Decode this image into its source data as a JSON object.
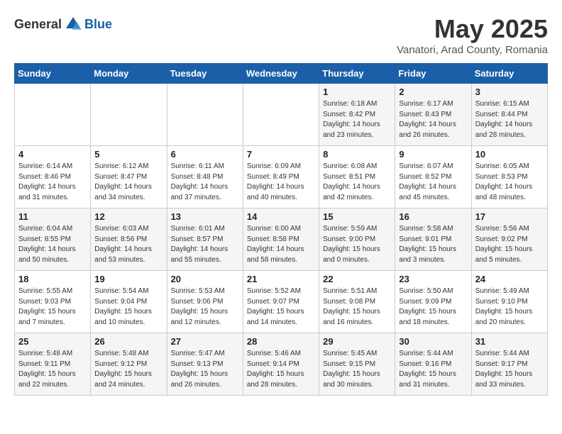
{
  "header": {
    "logo_general": "General",
    "logo_blue": "Blue",
    "month": "May 2025",
    "location": "Vanatori, Arad County, Romania"
  },
  "weekdays": [
    "Sunday",
    "Monday",
    "Tuesday",
    "Wednesday",
    "Thursday",
    "Friday",
    "Saturday"
  ],
  "weeks": [
    [
      {
        "day": "",
        "info": ""
      },
      {
        "day": "",
        "info": ""
      },
      {
        "day": "",
        "info": ""
      },
      {
        "day": "",
        "info": ""
      },
      {
        "day": "1",
        "info": "Sunrise: 6:18 AM\nSunset: 8:42 PM\nDaylight: 14 hours\nand 23 minutes."
      },
      {
        "day": "2",
        "info": "Sunrise: 6:17 AM\nSunset: 8:43 PM\nDaylight: 14 hours\nand 26 minutes."
      },
      {
        "day": "3",
        "info": "Sunrise: 6:15 AM\nSunset: 8:44 PM\nDaylight: 14 hours\nand 28 minutes."
      }
    ],
    [
      {
        "day": "4",
        "info": "Sunrise: 6:14 AM\nSunset: 8:46 PM\nDaylight: 14 hours\nand 31 minutes."
      },
      {
        "day": "5",
        "info": "Sunrise: 6:12 AM\nSunset: 8:47 PM\nDaylight: 14 hours\nand 34 minutes."
      },
      {
        "day": "6",
        "info": "Sunrise: 6:11 AM\nSunset: 8:48 PM\nDaylight: 14 hours\nand 37 minutes."
      },
      {
        "day": "7",
        "info": "Sunrise: 6:09 AM\nSunset: 8:49 PM\nDaylight: 14 hours\nand 40 minutes."
      },
      {
        "day": "8",
        "info": "Sunrise: 6:08 AM\nSunset: 8:51 PM\nDaylight: 14 hours\nand 42 minutes."
      },
      {
        "day": "9",
        "info": "Sunrise: 6:07 AM\nSunset: 8:52 PM\nDaylight: 14 hours\nand 45 minutes."
      },
      {
        "day": "10",
        "info": "Sunrise: 6:05 AM\nSunset: 8:53 PM\nDaylight: 14 hours\nand 48 minutes."
      }
    ],
    [
      {
        "day": "11",
        "info": "Sunrise: 6:04 AM\nSunset: 8:55 PM\nDaylight: 14 hours\nand 50 minutes."
      },
      {
        "day": "12",
        "info": "Sunrise: 6:03 AM\nSunset: 8:56 PM\nDaylight: 14 hours\nand 53 minutes."
      },
      {
        "day": "13",
        "info": "Sunrise: 6:01 AM\nSunset: 8:57 PM\nDaylight: 14 hours\nand 55 minutes."
      },
      {
        "day": "14",
        "info": "Sunrise: 6:00 AM\nSunset: 8:58 PM\nDaylight: 14 hours\nand 58 minutes."
      },
      {
        "day": "15",
        "info": "Sunrise: 5:59 AM\nSunset: 9:00 PM\nDaylight: 15 hours\nand 0 minutes."
      },
      {
        "day": "16",
        "info": "Sunrise: 5:58 AM\nSunset: 9:01 PM\nDaylight: 15 hours\nand 3 minutes."
      },
      {
        "day": "17",
        "info": "Sunrise: 5:56 AM\nSunset: 9:02 PM\nDaylight: 15 hours\nand 5 minutes."
      }
    ],
    [
      {
        "day": "18",
        "info": "Sunrise: 5:55 AM\nSunset: 9:03 PM\nDaylight: 15 hours\nand 7 minutes."
      },
      {
        "day": "19",
        "info": "Sunrise: 5:54 AM\nSunset: 9:04 PM\nDaylight: 15 hours\nand 10 minutes."
      },
      {
        "day": "20",
        "info": "Sunrise: 5:53 AM\nSunset: 9:06 PM\nDaylight: 15 hours\nand 12 minutes."
      },
      {
        "day": "21",
        "info": "Sunrise: 5:52 AM\nSunset: 9:07 PM\nDaylight: 15 hours\nand 14 minutes."
      },
      {
        "day": "22",
        "info": "Sunrise: 5:51 AM\nSunset: 9:08 PM\nDaylight: 15 hours\nand 16 minutes."
      },
      {
        "day": "23",
        "info": "Sunrise: 5:50 AM\nSunset: 9:09 PM\nDaylight: 15 hours\nand 18 minutes."
      },
      {
        "day": "24",
        "info": "Sunrise: 5:49 AM\nSunset: 9:10 PM\nDaylight: 15 hours\nand 20 minutes."
      }
    ],
    [
      {
        "day": "25",
        "info": "Sunrise: 5:48 AM\nSunset: 9:11 PM\nDaylight: 15 hours\nand 22 minutes."
      },
      {
        "day": "26",
        "info": "Sunrise: 5:48 AM\nSunset: 9:12 PM\nDaylight: 15 hours\nand 24 minutes."
      },
      {
        "day": "27",
        "info": "Sunrise: 5:47 AM\nSunset: 9:13 PM\nDaylight: 15 hours\nand 26 minutes."
      },
      {
        "day": "28",
        "info": "Sunrise: 5:46 AM\nSunset: 9:14 PM\nDaylight: 15 hours\nand 28 minutes."
      },
      {
        "day": "29",
        "info": "Sunrise: 5:45 AM\nSunset: 9:15 PM\nDaylight: 15 hours\nand 30 minutes."
      },
      {
        "day": "30",
        "info": "Sunrise: 5:44 AM\nSunset: 9:16 PM\nDaylight: 15 hours\nand 31 minutes."
      },
      {
        "day": "31",
        "info": "Sunrise: 5:44 AM\nSunset: 9:17 PM\nDaylight: 15 hours\nand 33 minutes."
      }
    ]
  ]
}
